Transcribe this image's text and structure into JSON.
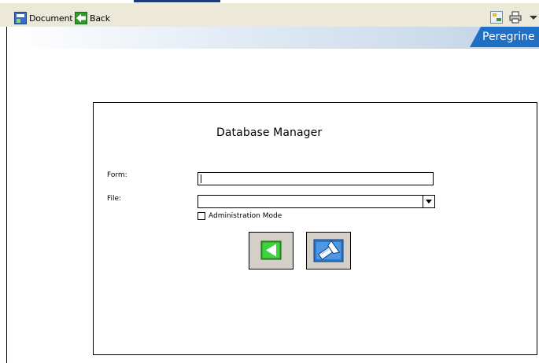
{
  "toolbar": {
    "document_label": "Document",
    "back_label": "Back"
  },
  "banner": {
    "brand": "Peregrine"
  },
  "dialog": {
    "title": "Database Manager",
    "form_label": "Form:",
    "form_value": "",
    "file_label": "File:",
    "file_value": "",
    "admin_label": "Administration Mode",
    "admin_checked": false
  },
  "buttons": {
    "back_icon": "green-left-arrow-icon",
    "search_icon": "flashlight-icon"
  }
}
